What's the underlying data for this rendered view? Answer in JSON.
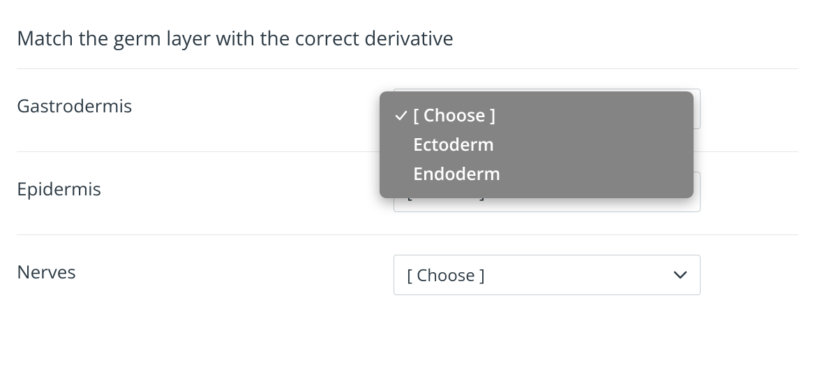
{
  "question": {
    "prompt": "Match the germ layer with the correct derivative"
  },
  "placeholder": "[ Choose ]",
  "rows": [
    {
      "term": "Gastrodermis",
      "value": "[ Choose ]",
      "open": true
    },
    {
      "term": "Epidermis",
      "value": "[ Choose ]",
      "open": false
    },
    {
      "term": "Nerves",
      "value": "[ Choose ]",
      "open": false
    }
  ],
  "dropdown": {
    "options": [
      {
        "label": "[ Choose ]",
        "selected": true
      },
      {
        "label": "Ectoderm",
        "selected": false
      },
      {
        "label": "Endoderm",
        "selected": false
      }
    ]
  }
}
